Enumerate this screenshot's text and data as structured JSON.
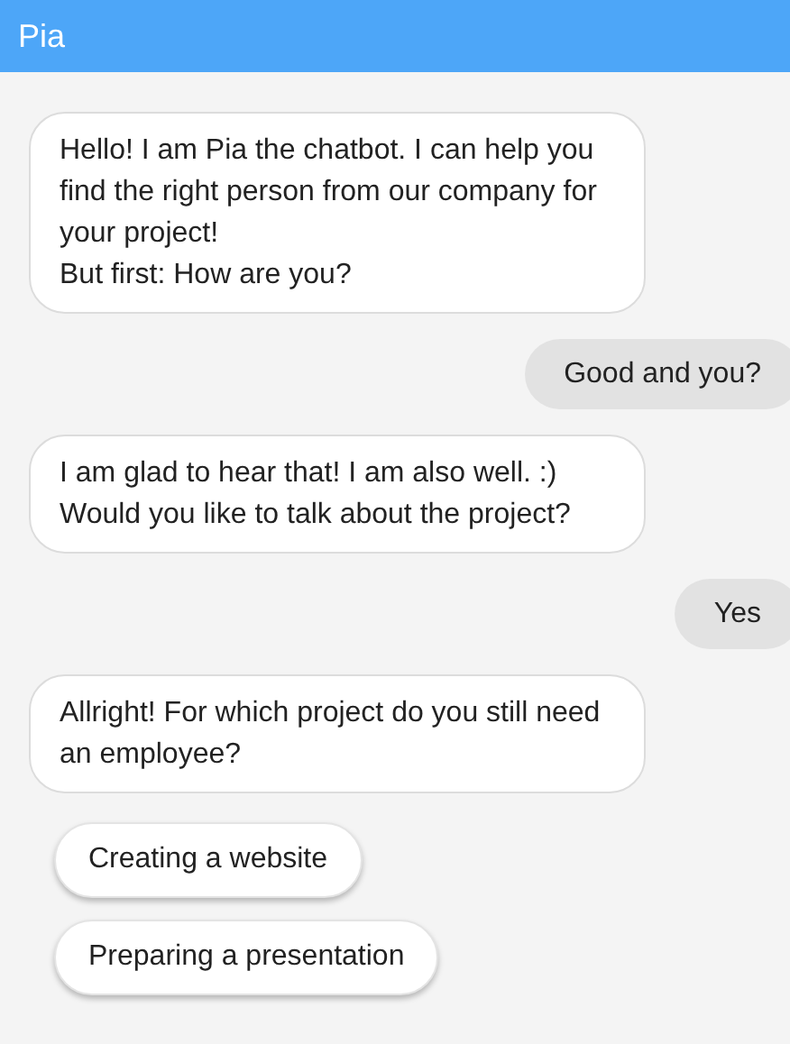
{
  "header": {
    "title": "Pia"
  },
  "messages": [
    {
      "kind": "bot",
      "lines": [
        "Hello! I am Pia the chatbot. I can help you find the right person from our company for your project!",
        "But first: How are you?"
      ]
    },
    {
      "kind": "user",
      "lines": [
        "Good and you?"
      ]
    },
    {
      "kind": "bot",
      "lines": [
        "I am glad to hear that! I am also well. :) Would you like to talk about the project?"
      ]
    },
    {
      "kind": "user",
      "lines": [
        "Yes"
      ]
    },
    {
      "kind": "bot",
      "lines": [
        "Allright! For which project do you still need an employee?"
      ]
    }
  ],
  "quick_replies": [
    "Creating a website",
    "Preparing a presentation"
  ]
}
